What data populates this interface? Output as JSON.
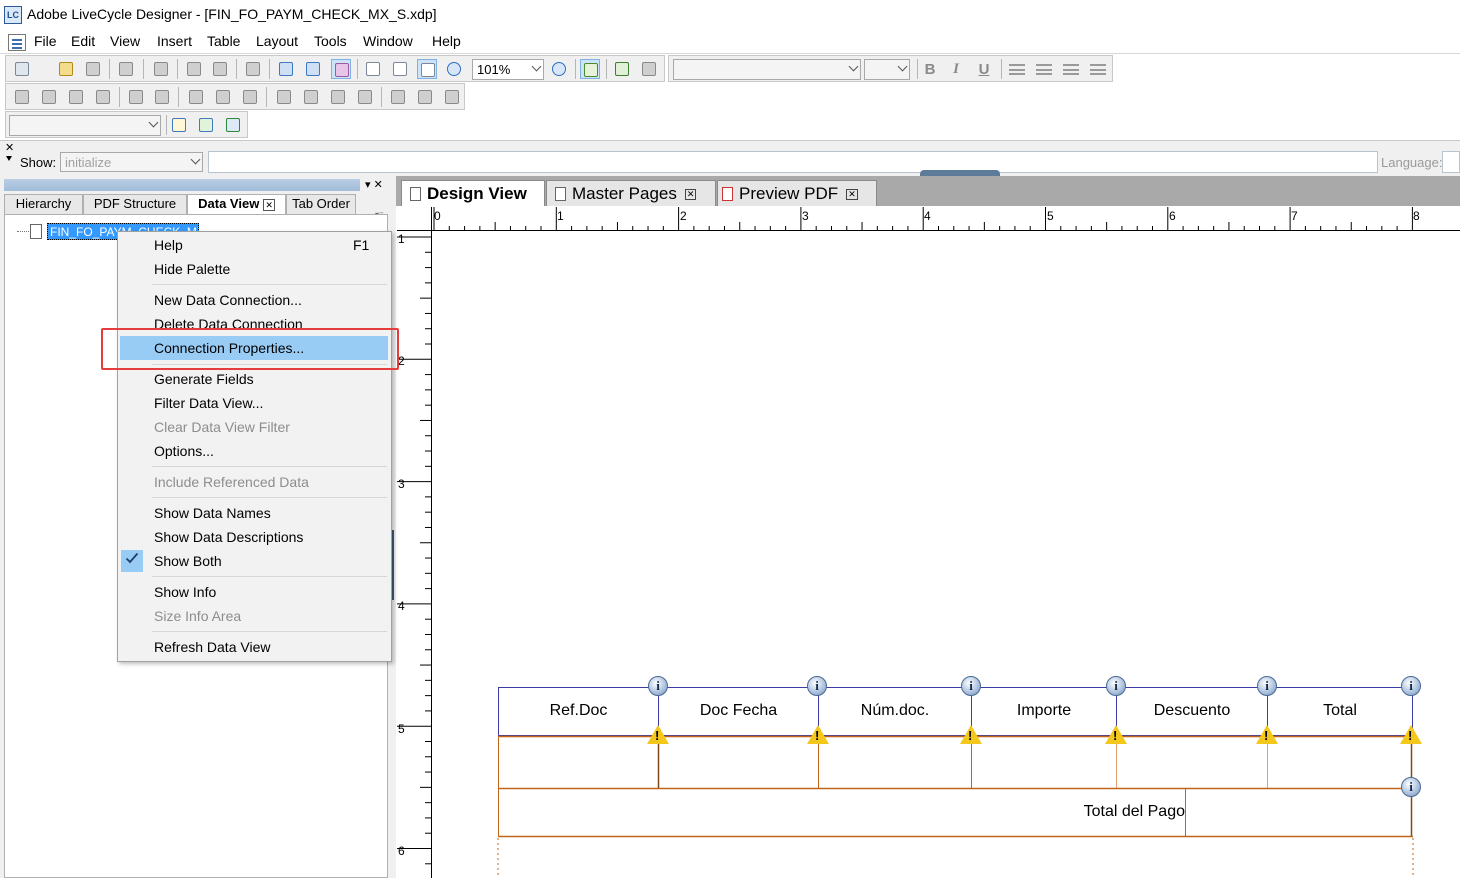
{
  "window": {
    "app_icon_text": "LC",
    "title": "Adobe LiveCycle Designer - [FIN_FO_PAYM_CHECK_MX_S.xdp]"
  },
  "menu": {
    "items": [
      "File",
      "Edit",
      "View",
      "Insert",
      "Table",
      "Layout",
      "Tools",
      "Window",
      "Help"
    ]
  },
  "toolbar": {
    "zoom_value": "101%",
    "font_name": "",
    "font_size": "",
    "bold": "B",
    "italic": "I",
    "underline": "U",
    "object_select": ""
  },
  "showbar": {
    "label": "Show:",
    "event_value": "initialize",
    "language_label": "Language:"
  },
  "left_panel": {
    "tabs": [
      "Hierarchy",
      "PDF Structure",
      "Data View",
      "Tab Order"
    ],
    "active_tab": "Data View",
    "tree_node": "FIN_FO_PAYM_CHECK_MX"
  },
  "context_menu": {
    "help": "Help",
    "help_shortcut": "F1",
    "hide_palette": "Hide Palette",
    "new_connection": "New Data Connection...",
    "delete_connection": "Delete Data Connection",
    "connection_properties": "Connection Properties...",
    "generate_fields": "Generate Fields",
    "filter_view": "Filter Data View...",
    "clear_filter": "Clear Data View Filter",
    "options": "Options...",
    "include_referenced": "Include Referenced Data",
    "show_names": "Show Data Names",
    "show_descriptions": "Show Data Descriptions",
    "show_both": "Show Both",
    "show_info": "Show Info",
    "size_info": "Size Info Area",
    "refresh": "Refresh Data View"
  },
  "design_tabs": {
    "design_view": "Design View",
    "master_pages": "Master Pages",
    "preview_pdf": "Preview PDF"
  },
  "rulers": {
    "horizontal": [
      "0",
      "1",
      "2",
      "3",
      "4",
      "5",
      "6",
      "7",
      "8"
    ],
    "vertical": [
      "1",
      "2",
      "3",
      "4",
      "5",
      "6"
    ]
  },
  "form": {
    "headers": [
      "Ref.Doc",
      "Doc Fecha",
      "Núm.doc.",
      "Importe",
      "Descuento",
      "Total"
    ],
    "total_label": "Total del Pago"
  },
  "colors": {
    "highlight": "#99ccf5",
    "red_callout": "#e53c3c",
    "table_header_border": "#3b3ba8",
    "table_body_border": "#c0641a"
  }
}
